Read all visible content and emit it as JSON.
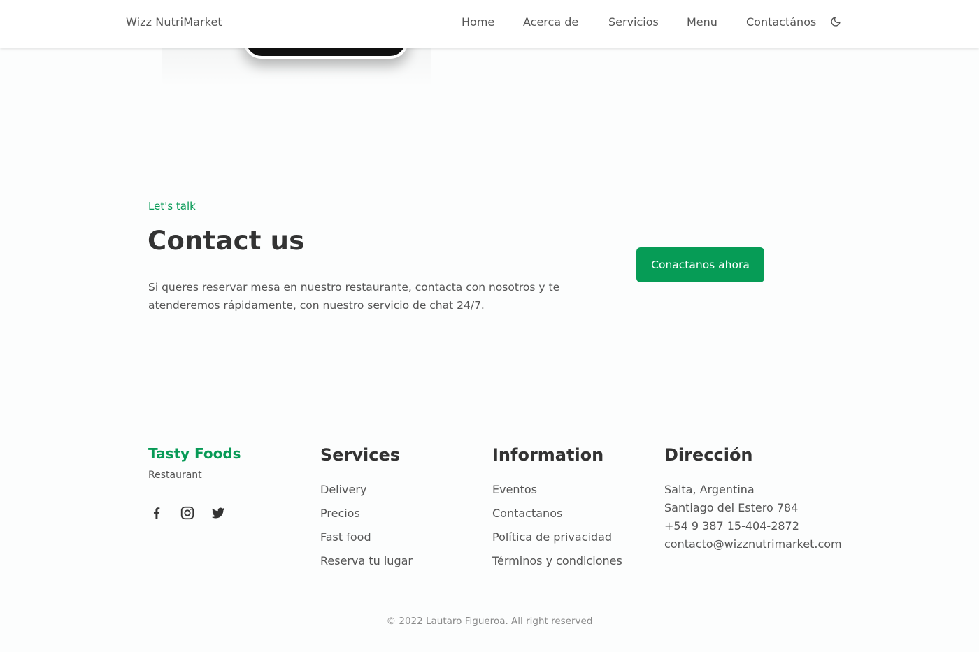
{
  "header": {
    "brand": "Wizz NutriMarket",
    "nav": [
      "Home",
      "Acerca de",
      "Servicios",
      "Menu",
      "Contactános"
    ],
    "theme_icon": "moon-icon"
  },
  "contact": {
    "subtitle": "Let's talk",
    "title": "Contact us",
    "description": "Si queres reservar mesa en nuestro restaurante, contacta con nosotros y te atenderemos rápidamente, con nuestro servicio de chat 24/7.",
    "button": "Conactanos ahora"
  },
  "footer": {
    "brand": "Tasty Foods",
    "tagline": "Restaurant",
    "social": [
      "facebook-icon",
      "instagram-icon",
      "twitter-icon"
    ],
    "services": {
      "title": "Services",
      "items": [
        "Delivery",
        "Precios",
        "Fast food",
        "Reserva tu lugar"
      ]
    },
    "information": {
      "title": "Information",
      "items": [
        "Eventos",
        "Contactanos",
        "Política de privacidad",
        "Términos y condiciones"
      ]
    },
    "address": {
      "title": "Dirección",
      "lines": [
        "Salta, Argentina",
        "Santiago del Estero 784",
        "+54 9 387 15-404-2872",
        "contacto@wizznutrimarket.com"
      ]
    },
    "copyright": "© 2022 Lautaro Figueroa. All right reserved"
  },
  "colors": {
    "accent": "#069c56",
    "text": "#333333",
    "muted": "#555555"
  }
}
